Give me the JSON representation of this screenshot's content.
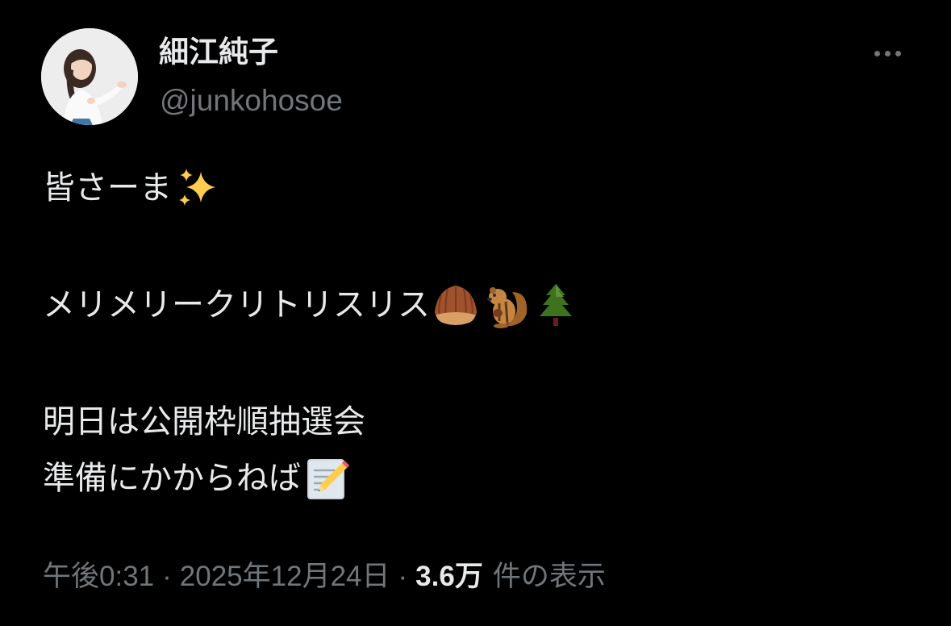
{
  "user": {
    "display_name": "細江純子",
    "handle": "@junkohosoe"
  },
  "tweet": {
    "line1": "皆さーま",
    "line2": "メリメリークリトリスリス",
    "line3": "明日は公開枠順抽選会",
    "line4": "準備にかからねば",
    "emojis": {
      "line1": [
        "sparkles-icon"
      ],
      "line2": [
        "chestnut-icon",
        "chipmunk-icon",
        "evergreen-tree-icon"
      ],
      "line4": [
        "memo-icon"
      ]
    }
  },
  "meta": {
    "time": "午後0:31",
    "separator": "·",
    "date": "2025年12月24日",
    "views_count": "3.6万",
    "views_label": "件の表示"
  },
  "colors": {
    "background": "#000000",
    "primary_text": "#e7e9ea",
    "secondary_text": "#71767b"
  }
}
